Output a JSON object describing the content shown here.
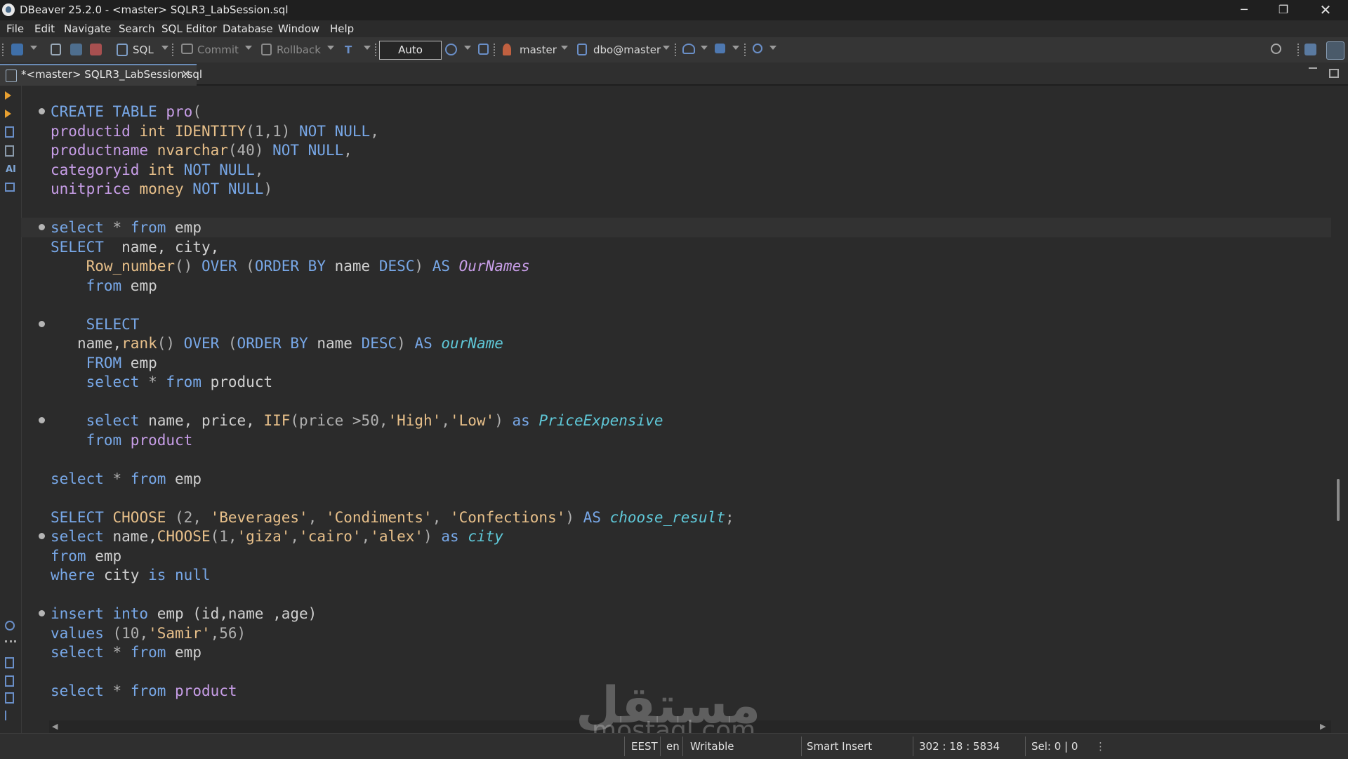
{
  "window": {
    "title": "DBeaver 25.2.0 - <master> SQLR3_LabSession.sql",
    "minimize": "─",
    "maximize": "❐",
    "close": "✕"
  },
  "menu": [
    "File",
    "Edit",
    "Navigate",
    "Search",
    "SQL Editor",
    "Database",
    "Window",
    "Help"
  ],
  "toolbar": {
    "sql_label": "SQL",
    "commit_label": "Commit",
    "rollback_label": "Rollback",
    "transaction_mode": "Auto",
    "datasource": "master",
    "schema": "dbo@master"
  },
  "editor_tab": {
    "label": "*<master> SQLR3_LabSession.sql",
    "close": "✕"
  },
  "gutter": {
    "ai_label": "AI"
  },
  "code_lines": [
    {
      "fold": true,
      "segs": [
        [
          "kw",
          "CREATE TABLE "
        ],
        [
          "id",
          "pro"
        ],
        [
          "pl",
          "("
        ]
      ]
    },
    {
      "fold": false,
      "segs": [
        [
          "id",
          "productid "
        ],
        [
          "ty",
          "int "
        ],
        [
          "fn",
          "IDENTITY"
        ],
        [
          "pl",
          "(1,1) "
        ],
        [
          "kw",
          "NOT NULL"
        ],
        [
          "pl",
          ","
        ]
      ]
    },
    {
      "fold": false,
      "segs": [
        [
          "id",
          "productname "
        ],
        [
          "ty",
          "nvarchar"
        ],
        [
          "pl",
          "(40) "
        ],
        [
          "kw",
          "NOT NULL"
        ],
        [
          "pl",
          ","
        ]
      ]
    },
    {
      "fold": false,
      "segs": [
        [
          "id",
          "categoryid "
        ],
        [
          "ty",
          "int "
        ],
        [
          "kw",
          "NOT NULL"
        ],
        [
          "pl",
          ","
        ]
      ]
    },
    {
      "fold": false,
      "segs": [
        [
          "id",
          "unitprice "
        ],
        [
          "ty",
          "money "
        ],
        [
          "kw",
          "NOT NULL"
        ],
        [
          "pl",
          ")"
        ]
      ]
    },
    {
      "fold": false,
      "segs": []
    },
    {
      "fold": true,
      "current": true,
      "segs": [
        [
          "kw",
          "select "
        ],
        [
          "pl",
          "* "
        ],
        [
          "kw",
          "from "
        ],
        [
          "nm",
          "emp"
        ]
      ]
    },
    {
      "fold": false,
      "segs": [
        [
          "kw",
          "SELECT  "
        ],
        [
          "nm",
          "name, city,"
        ]
      ]
    },
    {
      "fold": false,
      "segs": [
        [
          "pl",
          "    "
        ],
        [
          "fn",
          "Row_number"
        ],
        [
          "pl",
          "() "
        ],
        [
          "kw",
          "OVER "
        ],
        [
          "pl",
          "("
        ],
        [
          "kw",
          "ORDER BY "
        ],
        [
          "nm",
          "name "
        ],
        [
          "kw",
          "DESC"
        ],
        [
          "pl",
          ") "
        ],
        [
          "kw",
          "AS "
        ],
        [
          "alp",
          "OurNames"
        ]
      ]
    },
    {
      "fold": false,
      "segs": [
        [
          "pl",
          "    "
        ],
        [
          "kw",
          "from "
        ],
        [
          "nm",
          "emp"
        ]
      ]
    },
    {
      "fold": false,
      "segs": []
    },
    {
      "fold": true,
      "segs": [
        [
          "pl",
          "    "
        ],
        [
          "kw",
          "SELECT"
        ]
      ]
    },
    {
      "fold": false,
      "segs": [
        [
          "pl",
          "   "
        ],
        [
          "nm",
          "name,"
        ],
        [
          "fn",
          "rank"
        ],
        [
          "pl",
          "() "
        ],
        [
          "kw",
          "OVER "
        ],
        [
          "pl",
          "("
        ],
        [
          "kw",
          "ORDER BY "
        ],
        [
          "nm",
          "name "
        ],
        [
          "kw",
          "DESC"
        ],
        [
          "pl",
          ") "
        ],
        [
          "kw",
          "AS "
        ],
        [
          "al",
          "ourName"
        ]
      ]
    },
    {
      "fold": false,
      "segs": [
        [
          "pl",
          "    "
        ],
        [
          "kw",
          "FROM "
        ],
        [
          "nm",
          "emp"
        ]
      ]
    },
    {
      "fold": false,
      "segs": [
        [
          "pl",
          "    "
        ],
        [
          "kw",
          "select "
        ],
        [
          "pl",
          "* "
        ],
        [
          "kw",
          "from "
        ],
        [
          "nm",
          "product"
        ]
      ]
    },
    {
      "fold": false,
      "segs": []
    },
    {
      "fold": true,
      "segs": [
        [
          "pl",
          "    "
        ],
        [
          "kw",
          "select "
        ],
        [
          "nm",
          "name, price, "
        ],
        [
          "fn",
          "IIF"
        ],
        [
          "pl",
          "(price >50,"
        ],
        [
          "st",
          "'High'"
        ],
        [
          "pl",
          ","
        ],
        [
          "st",
          "'Low'"
        ],
        [
          "pl",
          ") "
        ],
        [
          "kw",
          "as "
        ],
        [
          "al",
          "PriceExpensive"
        ]
      ]
    },
    {
      "fold": false,
      "segs": [
        [
          "pl",
          "    "
        ],
        [
          "kw",
          "from "
        ],
        [
          "id",
          "product"
        ]
      ]
    },
    {
      "fold": false,
      "segs": []
    },
    {
      "fold": false,
      "segs": [
        [
          "kw",
          "select "
        ],
        [
          "pl",
          "* "
        ],
        [
          "kw",
          "from "
        ],
        [
          "nm",
          "emp"
        ]
      ]
    },
    {
      "fold": false,
      "segs": []
    },
    {
      "fold": false,
      "segs": [
        [
          "kw",
          "SELECT "
        ],
        [
          "fn",
          "CHOOSE "
        ],
        [
          "pl",
          "(2, "
        ],
        [
          "st",
          "'Beverages'"
        ],
        [
          "pl",
          ", "
        ],
        [
          "st",
          "'Condiments'"
        ],
        [
          "pl",
          ", "
        ],
        [
          "st",
          "'Confections'"
        ],
        [
          "pl",
          ") "
        ],
        [
          "kw",
          "AS "
        ],
        [
          "al",
          "choose_result"
        ],
        [
          "pl",
          ";"
        ]
      ]
    },
    {
      "fold": true,
      "segs": [
        [
          "kw",
          "select "
        ],
        [
          "nm",
          "name,"
        ],
        [
          "fn",
          "CHOOSE"
        ],
        [
          "pl",
          "(1,"
        ],
        [
          "st",
          "'giza'"
        ],
        [
          "pl",
          ","
        ],
        [
          "st",
          "'cairo'"
        ],
        [
          "pl",
          ","
        ],
        [
          "st",
          "'alex'"
        ],
        [
          "pl",
          ") "
        ],
        [
          "kw",
          "as "
        ],
        [
          "al",
          "city"
        ]
      ]
    },
    {
      "fold": false,
      "segs": [
        [
          "kw",
          "from "
        ],
        [
          "nm",
          "emp"
        ]
      ]
    },
    {
      "fold": false,
      "segs": [
        [
          "kw",
          "where "
        ],
        [
          "nm",
          "city "
        ],
        [
          "kw",
          "is null"
        ]
      ]
    },
    {
      "fold": false,
      "segs": []
    },
    {
      "fold": true,
      "segs": [
        [
          "kw",
          "insert into "
        ],
        [
          "nm",
          "emp (id,name ,age)"
        ]
      ]
    },
    {
      "fold": false,
      "segs": [
        [
          "kw",
          "values "
        ],
        [
          "pl",
          "(10,"
        ],
        [
          "st",
          "'Samir'"
        ],
        [
          "pl",
          ",56)"
        ]
      ]
    },
    {
      "fold": false,
      "segs": [
        [
          "kw",
          "select "
        ],
        [
          "pl",
          "* "
        ],
        [
          "kw",
          "from "
        ],
        [
          "nm",
          "emp"
        ]
      ]
    },
    {
      "fold": false,
      "segs": []
    },
    {
      "fold": false,
      "segs": [
        [
          "kw",
          "select "
        ],
        [
          "pl",
          "* "
        ],
        [
          "kw",
          "from "
        ],
        [
          "id",
          "product"
        ]
      ]
    }
  ],
  "watermark": {
    "arabic": "مستقل",
    "latin": "mostaql.com"
  },
  "statusbar": {
    "timezone": "EEST",
    "locale": "en",
    "mode": "Writable",
    "insert_mode": "Smart Insert",
    "position": "302 : 18 : 5834",
    "selection": "Sel: 0 | 0"
  },
  "colors": {
    "keyword": "#78a8e8",
    "type": "#e8c08a",
    "identifier": "#c89ee8",
    "alias": "#5fc8d8",
    "background": "#2b2b2b"
  }
}
